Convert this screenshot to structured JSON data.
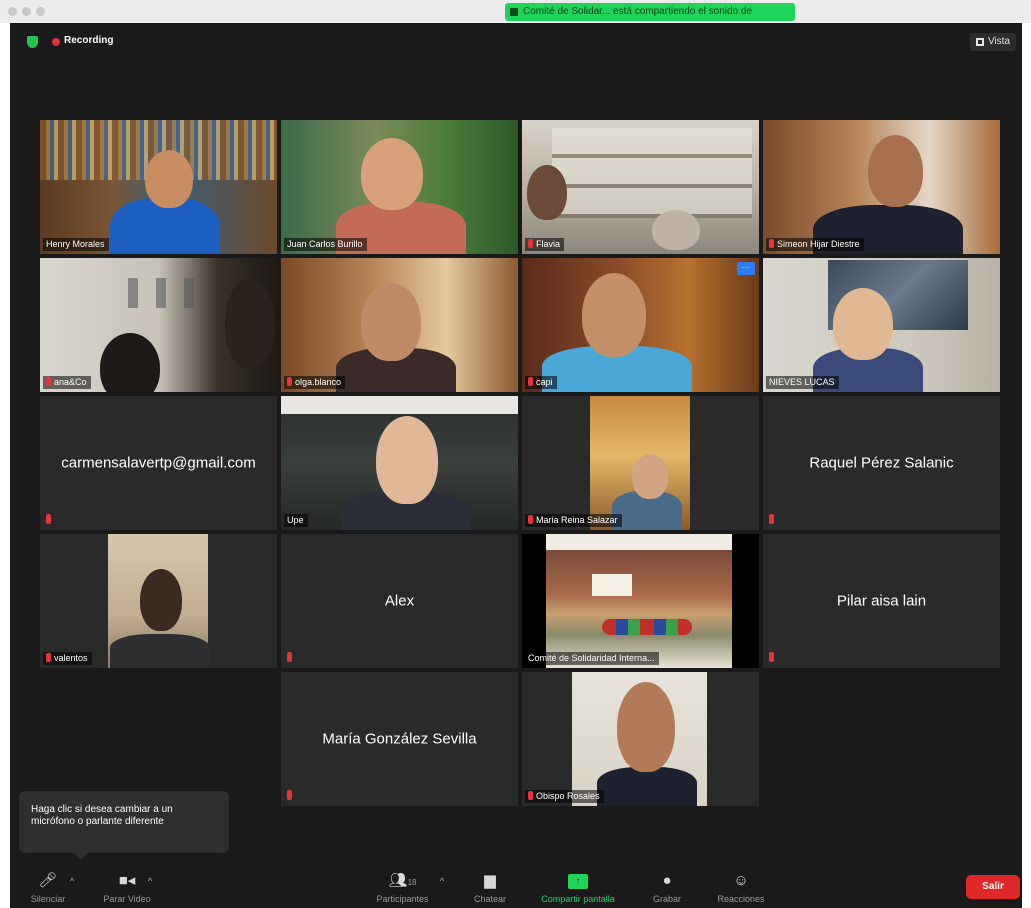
{
  "titlebar": {
    "share_banner": "Comité de Solidar... está compartiendo el sonido de"
  },
  "meeting": {
    "recording_label": "Recording",
    "view_label": "Vista"
  },
  "tiles": [
    {
      "name": "Henry Morales",
      "muted": false
    },
    {
      "name": "Juan Carlos Burillo",
      "muted": false
    },
    {
      "name": "Flavia",
      "muted": true
    },
    {
      "name": "Simeon Hijar Diestre",
      "muted": true
    },
    {
      "name": "ana&Co",
      "muted": true
    },
    {
      "name": "olga.blanco",
      "muted": true
    },
    {
      "name": "capi",
      "muted": true
    },
    {
      "name": "NIEVES LUCAS",
      "muted": false
    },
    {
      "name": "carmensalavertp@gmail.com",
      "muted": true
    },
    {
      "name": "Upe",
      "muted": false
    },
    {
      "name": "Maria Reina Salazar",
      "muted": true
    },
    {
      "name": "Raquel Pérez Salanic",
      "muted": true
    },
    {
      "name": "valentos",
      "muted": true
    },
    {
      "name": "Alex",
      "muted": true
    },
    {
      "name": "Comité de Solidaridad Interna...",
      "muted": false
    },
    {
      "name": "Pilar aisa lain",
      "muted": true
    },
    {
      "name": "María González Sevilla",
      "muted": true
    },
    {
      "name": "Obispo Rosales",
      "muted": true
    }
  ],
  "tooltip": {
    "text": "Haga clic si desea cambiar a un micrófono o parlante diferente"
  },
  "toolbar": {
    "mute_label": "Silenciar",
    "video_label": "Parar Video",
    "participants_label": "Participantes",
    "participants_count": "18",
    "chat_label": "Chatear",
    "share_label": "Compartir pantalla",
    "record_label": "Grabar",
    "reactions_label": "Reacciones",
    "exit_label": "Salir"
  },
  "colors": {
    "accent_green": "#1fd45a",
    "recording_red": "#e5343a",
    "exit_red": "#e02828",
    "active_speaker_border": "#d4d88a"
  }
}
